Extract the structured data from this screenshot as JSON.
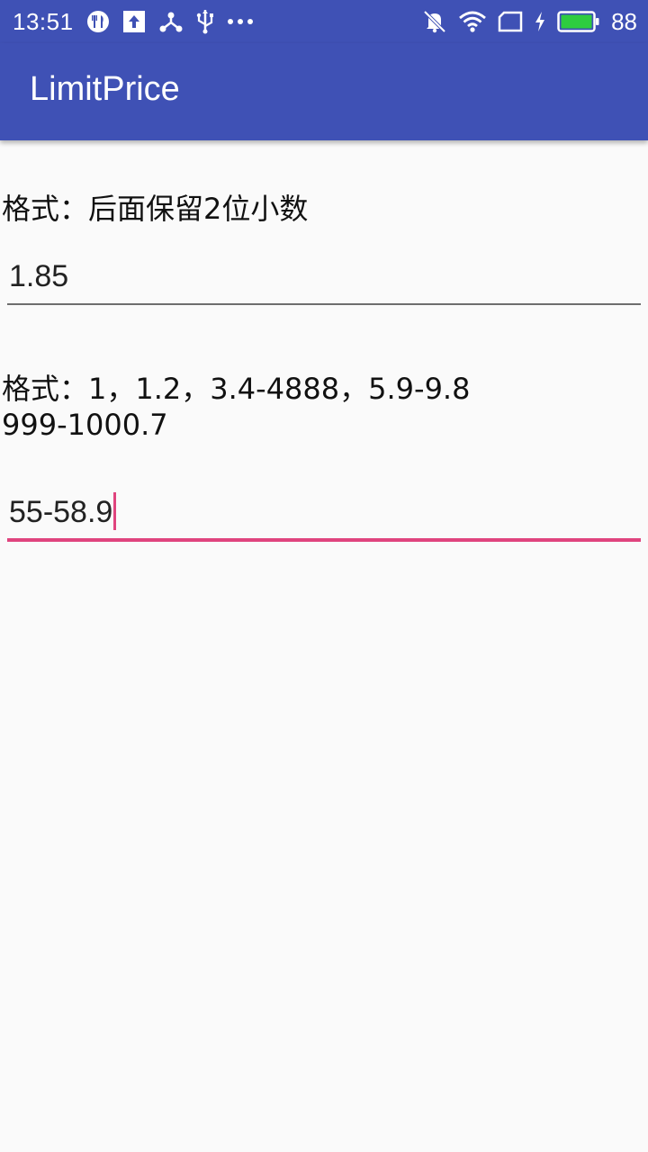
{
  "status_bar": {
    "time": "13:51",
    "battery_level": "88",
    "icons_left": [
      "fork-knife-icon",
      "upload-icon",
      "share-icon",
      "usb-icon",
      "more-icon"
    ],
    "icons_right": [
      "mute-icon",
      "wifi-icon",
      "sim-icon",
      "charging-icon",
      "battery-icon"
    ],
    "battery_fill_color": "#2ecc40"
  },
  "app_bar": {
    "title": "LimitPrice",
    "color": "#3f51b5"
  },
  "section1": {
    "label": "格式：后面保留2位小数",
    "input_value": "1.85"
  },
  "section2": {
    "label": "格式：1，1.2，3.4-4888，5.9-9.8\n999-1000.7",
    "input_value": "55-58.9"
  },
  "colors": {
    "accent": "#e0447e",
    "divider": "#6d6d6d",
    "background": "#fafafa"
  }
}
